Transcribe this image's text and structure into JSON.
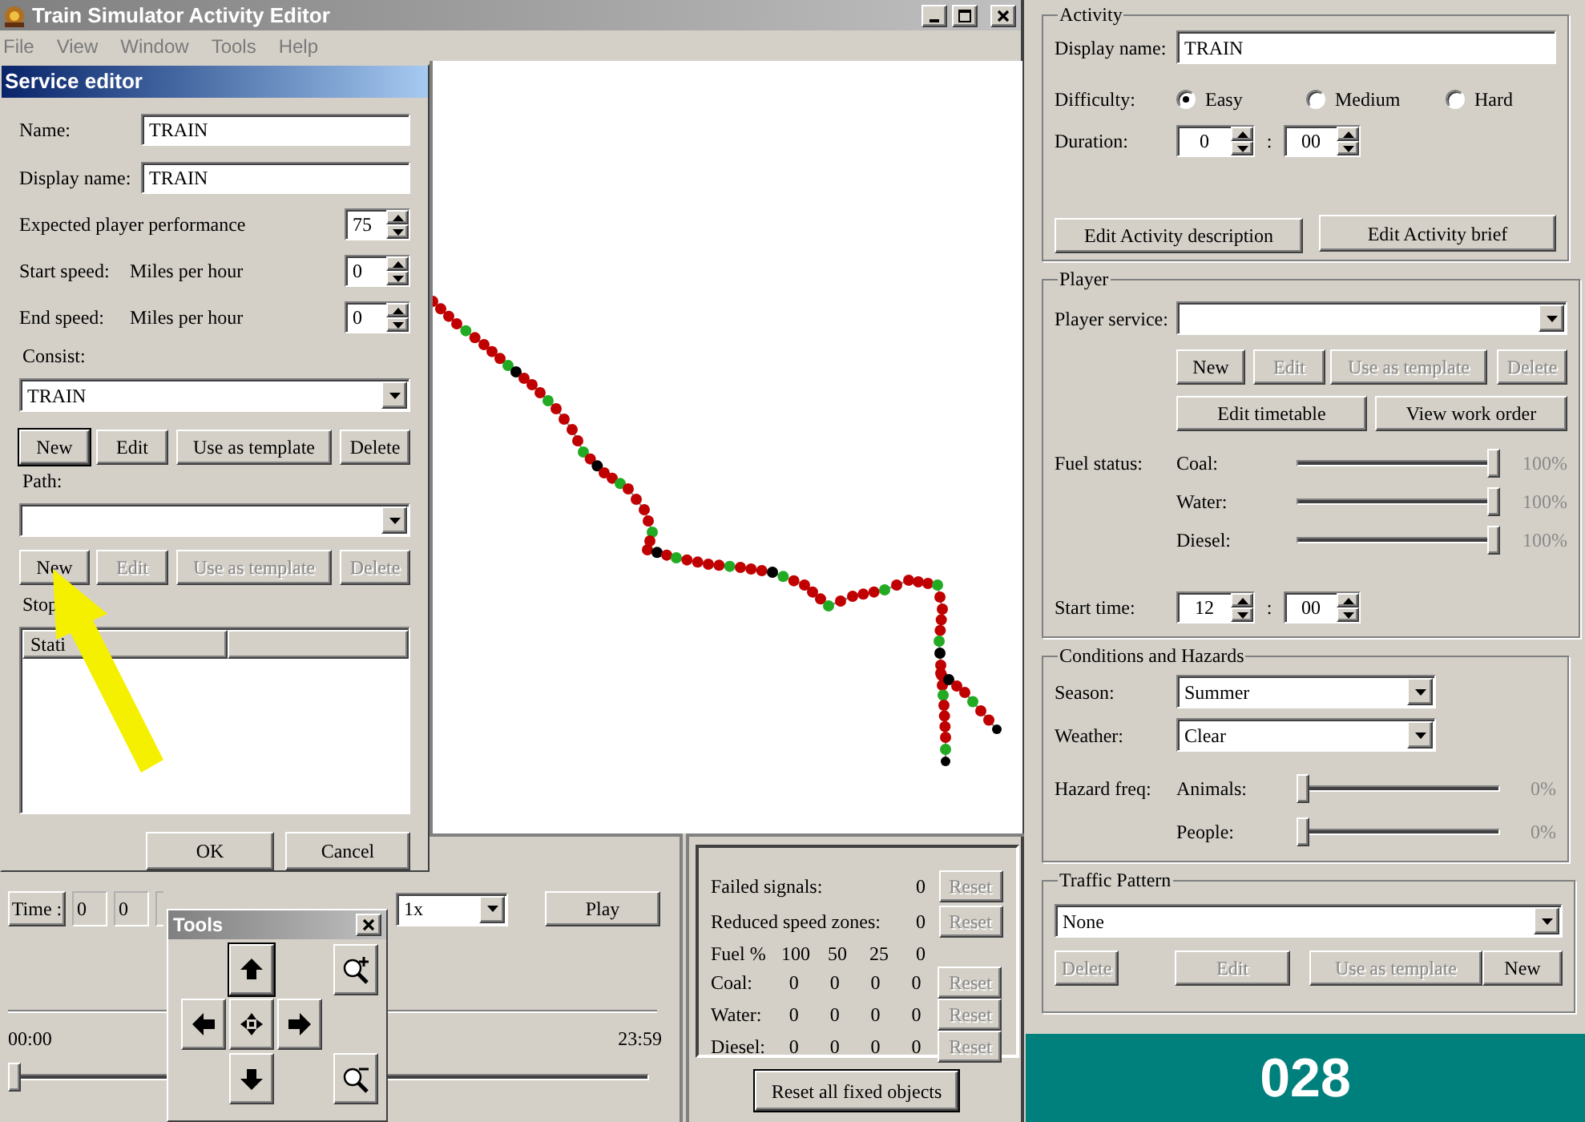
{
  "window": {
    "title": "Train Simulator Activity Editor"
  },
  "menu": [
    "File",
    "View",
    "Window",
    "Tools",
    "Help"
  ],
  "service_editor": {
    "title": "Service editor",
    "name_label": "Name:",
    "name": "TRAIN",
    "display_name_label": "Display name:",
    "display_name": "TRAIN",
    "performance_label": "Expected player performance",
    "performance": "75",
    "start_speed_label": "Start speed:",
    "start_speed_unit": "Miles per hour",
    "start_speed": "0",
    "end_speed_label": "End speed:",
    "end_speed_unit": "Miles per hour",
    "end_speed": "0",
    "consist_label": "Consist:",
    "consist": "TRAIN",
    "consist_buttons": [
      {
        "label": "New",
        "disabled": false,
        "focused": true
      },
      {
        "label": "Edit",
        "disabled": false,
        "focused": false
      },
      {
        "label": "Use as template",
        "disabled": false,
        "focused": false
      },
      {
        "label": "Delete",
        "disabled": false,
        "focused": false
      }
    ],
    "path_label": "Path:",
    "path_buttons": [
      {
        "label": "New",
        "disabled": false
      },
      {
        "label": "Edit",
        "disabled": true
      },
      {
        "label": "Use as template",
        "disabled": true
      },
      {
        "label": "Delete",
        "disabled": true
      }
    ],
    "stops_label": "Stop",
    "stops_columns": [
      "Stati"
    ],
    "buttons": [
      "OK",
      "Cancel"
    ]
  },
  "tools": {
    "title": "Tools"
  },
  "time_controls": {
    "time_label": "Time :",
    "time_fields": [
      "0",
      "0"
    ],
    "acceleration": "1x",
    "play": "Play",
    "start": "00:00",
    "end": "23:59",
    "level": 0
  },
  "statistics": {
    "rows": [
      {
        "label": "Failed signals:",
        "value": "0",
        "reset": "Reset",
        "disabled": true
      },
      {
        "label": "Reduced speed zones:",
        "value": "0",
        "reset": "Reset",
        "disabled": true
      }
    ],
    "fuel_header": [
      "Fuel %",
      "100",
      "50",
      "25",
      "0"
    ],
    "fuel_rows": [
      {
        "label": "Coal:",
        "values": [
          "0",
          "0",
          "0",
          "0"
        ],
        "reset": "Reset",
        "disabled": true
      },
      {
        "label": "Water:",
        "values": [
          "0",
          "0",
          "0",
          "0"
        ],
        "reset": "Reset",
        "disabled": true
      },
      {
        "label": "Diesel:",
        "values": [
          "0",
          "0",
          "0",
          "0"
        ],
        "reset": "Reset",
        "disabled": true
      }
    ],
    "reset_all": "Reset all fixed objects"
  },
  "activity": {
    "title": "Activity",
    "display_name_label": "Display name:",
    "display_name": "TRAIN",
    "difficulty_label": "Difficulty:",
    "difficulty": [
      {
        "label": "Easy",
        "selected": true
      },
      {
        "label": "Medium",
        "selected": false
      },
      {
        "label": "Hard",
        "selected": false
      }
    ],
    "duration_label": "Duration:",
    "duration": {
      "hours": "0",
      "separator": ":",
      "minutes": "00"
    },
    "buttons": [
      "Edit Activity description",
      "Edit Activity brief"
    ]
  },
  "player": {
    "title": "Player",
    "service_label": "Player service:",
    "buttons": [
      {
        "label": "New",
        "disabled": false
      },
      {
        "label": "Edit",
        "disabled": true
      },
      {
        "label": "Use as template",
        "disabled": true
      },
      {
        "label": "Delete",
        "disabled": true
      }
    ],
    "buttons_2": [
      "Edit timetable",
      "View work order"
    ],
    "fuel_label": "Fuel status:",
    "fuel": [
      {
        "name": "Coal:",
        "level": 1,
        "reading": "100%"
      },
      {
        "name": "Water:",
        "level": 1,
        "reading": "100%"
      },
      {
        "name": "Diesel:",
        "level": 1,
        "reading": "100%"
      }
    ],
    "start_time_label": "Start time:",
    "start_time": {
      "hours": "12",
      "separator": ":",
      "minutes": "00"
    }
  },
  "conditions": {
    "title": "Conditions and Hazards",
    "season_label": "Season:",
    "season": "Summer",
    "weather_label": "Weather:",
    "weather": "Clear",
    "hazard_label": "Hazard freq:",
    "hazards": [
      {
        "name": "Animals:",
        "level": 0,
        "reading": "0%"
      },
      {
        "name": "People:",
        "level": 0,
        "reading": "0%"
      }
    ]
  },
  "traffic": {
    "title": "Traffic Pattern",
    "pattern": "None",
    "buttons": [
      {
        "label": "Delete",
        "disabled": true
      },
      {
        "label": "Edit",
        "disabled": true
      },
      {
        "label": "Use as template",
        "disabled": true
      },
      {
        "label": "New",
        "disabled": false
      }
    ]
  },
  "overlay_label": "028"
}
